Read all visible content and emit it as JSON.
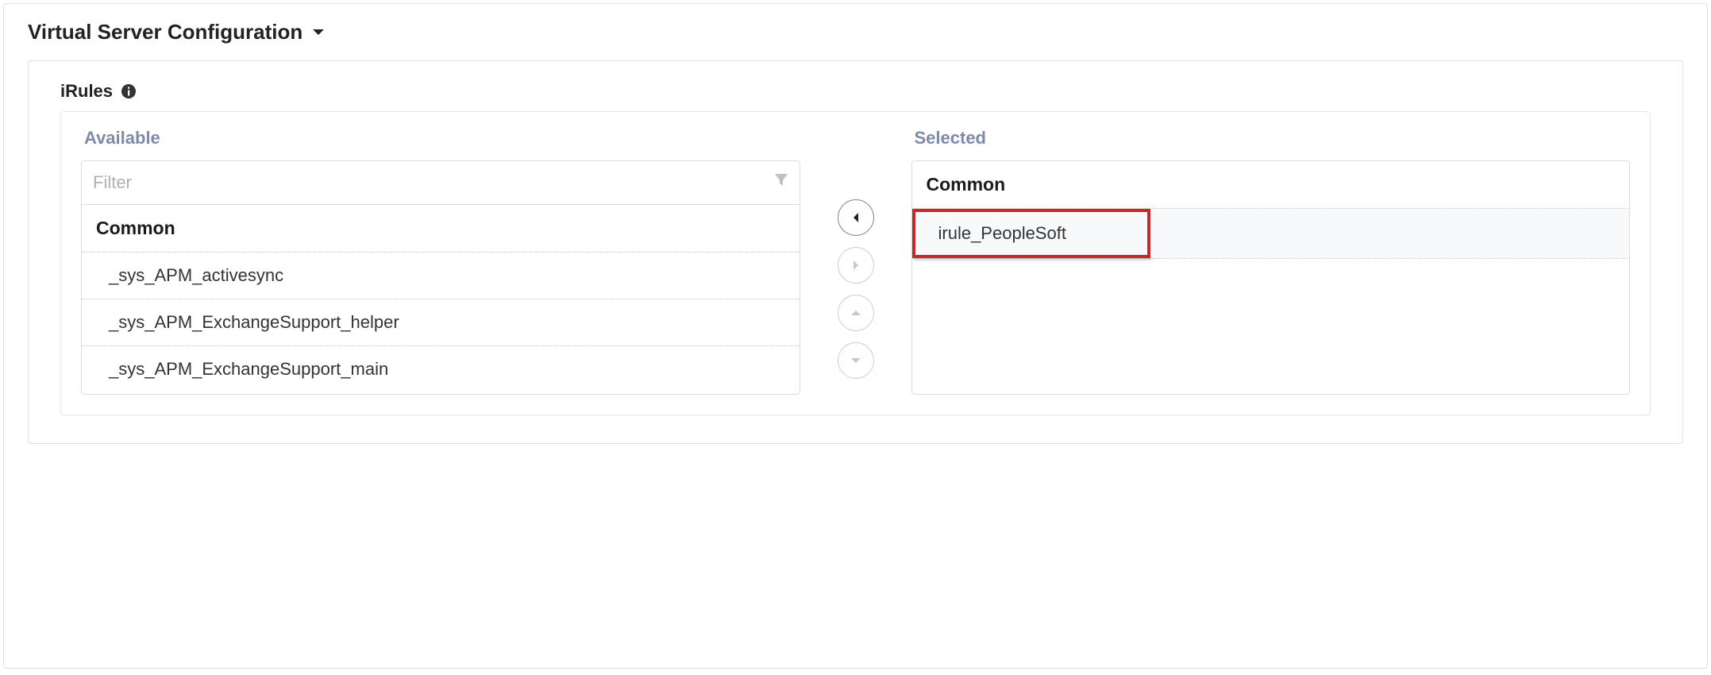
{
  "section": {
    "title": "Virtual Server Configuration"
  },
  "field": {
    "label": "iRules"
  },
  "duallist": {
    "available_label": "Available",
    "selected_label": "Selected",
    "filter_placeholder": "Filter",
    "available": {
      "group": "Common",
      "items": [
        "_sys_APM_activesync",
        "_sys_APM_ExchangeSupport_helper",
        "_sys_APM_ExchangeSupport_main"
      ]
    },
    "selected": {
      "group": "Common",
      "items": [
        "irule_PeopleSoft"
      ]
    }
  }
}
